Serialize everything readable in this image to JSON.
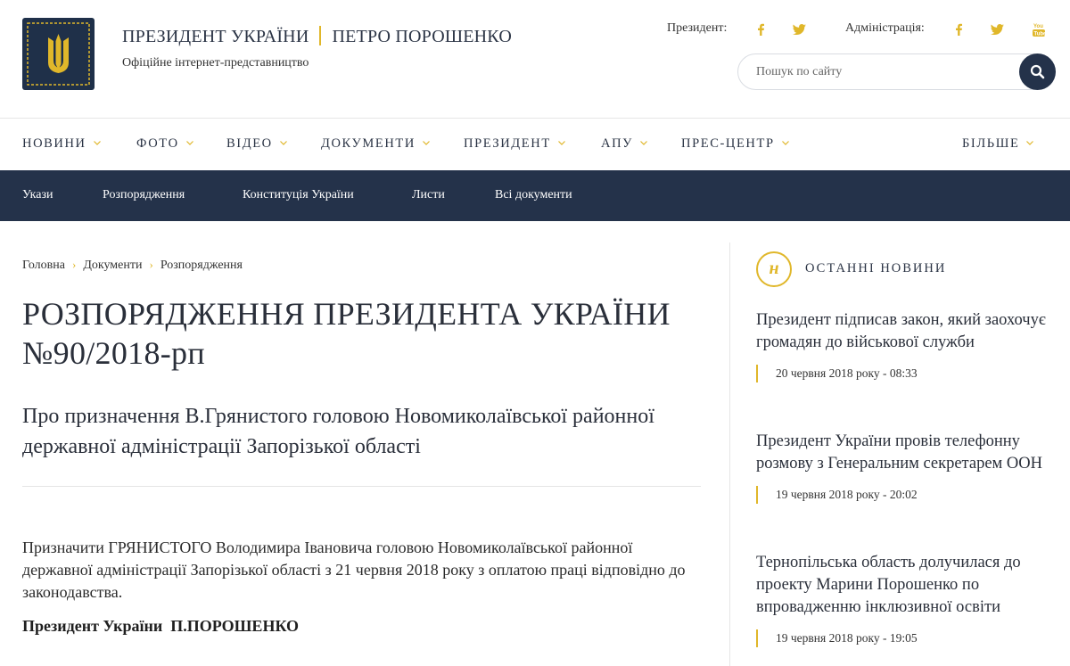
{
  "header": {
    "title_left": "ПРЕЗИДЕНТ УКРАЇНИ",
    "title_right": "ПЕТРО ПОРОШЕНКО",
    "subtitle": "Офіційне інтернет-представництво",
    "social_president_label": "Президент:",
    "social_admin_label": "Адміністрація:",
    "search_placeholder": "Пошук по сайту"
  },
  "nav": {
    "items": [
      "НОВИНИ",
      "ФОТО",
      "ВІДЕО",
      "ДОКУМЕНТИ",
      "ПРЕЗИДЕНТ",
      "АПУ",
      "ПРЕС-ЦЕНТР"
    ],
    "more": "БІЛЬШЕ"
  },
  "subnav": {
    "items": [
      "Укази",
      "Розпорядження",
      "Конституція України",
      "Листи",
      "Всі документи"
    ]
  },
  "breadcrumb": [
    "Головна",
    "Документи",
    "Розпорядження"
  ],
  "document": {
    "title": "РОЗПОРЯДЖЕННЯ ПРЕЗИДЕНТА УКРАЇНИ №90/2018-рп",
    "subtitle": "Про призначення В.Грянистого головою Новомиколаївської районної державної адміністрації Запорізької області",
    "body": "Призначити ГРЯНИСТОГО Володимира Івановича головою Новомиколаївської районної державної адміністрації Запорізької області з 21 червня 2018 року з оплатою праці відповідно до законодавства.",
    "signature": "Президент України  П.ПОРОШЕНКО"
  },
  "sidebar": {
    "icon_letter": "н",
    "heading": "ОСТАННІ НОВИНИ",
    "news": [
      {
        "title": "Президент підписав закон, який заохочує громадян до військової служби",
        "date": "20 червня 2018 року - 08:33"
      },
      {
        "title": "Президент України провів телефонну розмову з Генеральним секретарем ООН",
        "date": "19 червня 2018 року - 20:02"
      },
      {
        "title": "Тернопільська область долучилася до проекту Марини Порошенко по впровадженню інклюзивної освіти",
        "date": "19 червня 2018 року - 19:05"
      }
    ]
  },
  "colors": {
    "navy": "#24324a",
    "gold": "#e0b72a"
  },
  "icons": {
    "social_president": [
      "facebook-icon",
      "twitter-icon"
    ],
    "social_admin": [
      "facebook-icon",
      "twitter-icon",
      "youtube-icon"
    ],
    "search_button": "search-icon",
    "nav_chevron": "chevron-down-icon",
    "breadcrumb_separator": "chevron-right-icon"
  }
}
